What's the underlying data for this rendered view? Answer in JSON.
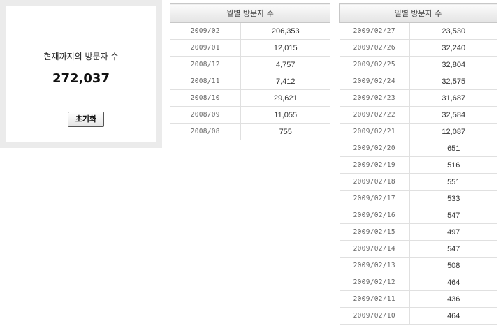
{
  "summary": {
    "label": "현재까지의 방문자 수",
    "count": "272,037",
    "reset_label": "초기화"
  },
  "monthly": {
    "header": "월별 방문자 수",
    "rows": [
      {
        "date": "2009/02",
        "count": "206,353"
      },
      {
        "date": "2009/01",
        "count": "12,015"
      },
      {
        "date": "2008/12",
        "count": "4,757"
      },
      {
        "date": "2008/11",
        "count": "7,412"
      },
      {
        "date": "2008/10",
        "count": "29,621"
      },
      {
        "date": "2008/09",
        "count": "11,055"
      },
      {
        "date": "2008/08",
        "count": "755"
      }
    ]
  },
  "daily": {
    "header": "일별 방문자 수",
    "rows": [
      {
        "date": "2009/02/27",
        "count": "23,530"
      },
      {
        "date": "2009/02/26",
        "count": "32,240"
      },
      {
        "date": "2009/02/25",
        "count": "32,804"
      },
      {
        "date": "2009/02/24",
        "count": "32,575"
      },
      {
        "date": "2009/02/23",
        "count": "31,687"
      },
      {
        "date": "2009/02/22",
        "count": "32,584"
      },
      {
        "date": "2009/02/21",
        "count": "12,087"
      },
      {
        "date": "2009/02/20",
        "count": "651"
      },
      {
        "date": "2009/02/19",
        "count": "516"
      },
      {
        "date": "2009/02/18",
        "count": "551"
      },
      {
        "date": "2009/02/17",
        "count": "533"
      },
      {
        "date": "2009/02/16",
        "count": "547"
      },
      {
        "date": "2009/02/15",
        "count": "497"
      },
      {
        "date": "2009/02/14",
        "count": "547"
      },
      {
        "date": "2009/02/13",
        "count": "508"
      },
      {
        "date": "2009/02/12",
        "count": "464"
      },
      {
        "date": "2009/02/11",
        "count": "436"
      },
      {
        "date": "2009/02/10",
        "count": "464"
      }
    ]
  }
}
